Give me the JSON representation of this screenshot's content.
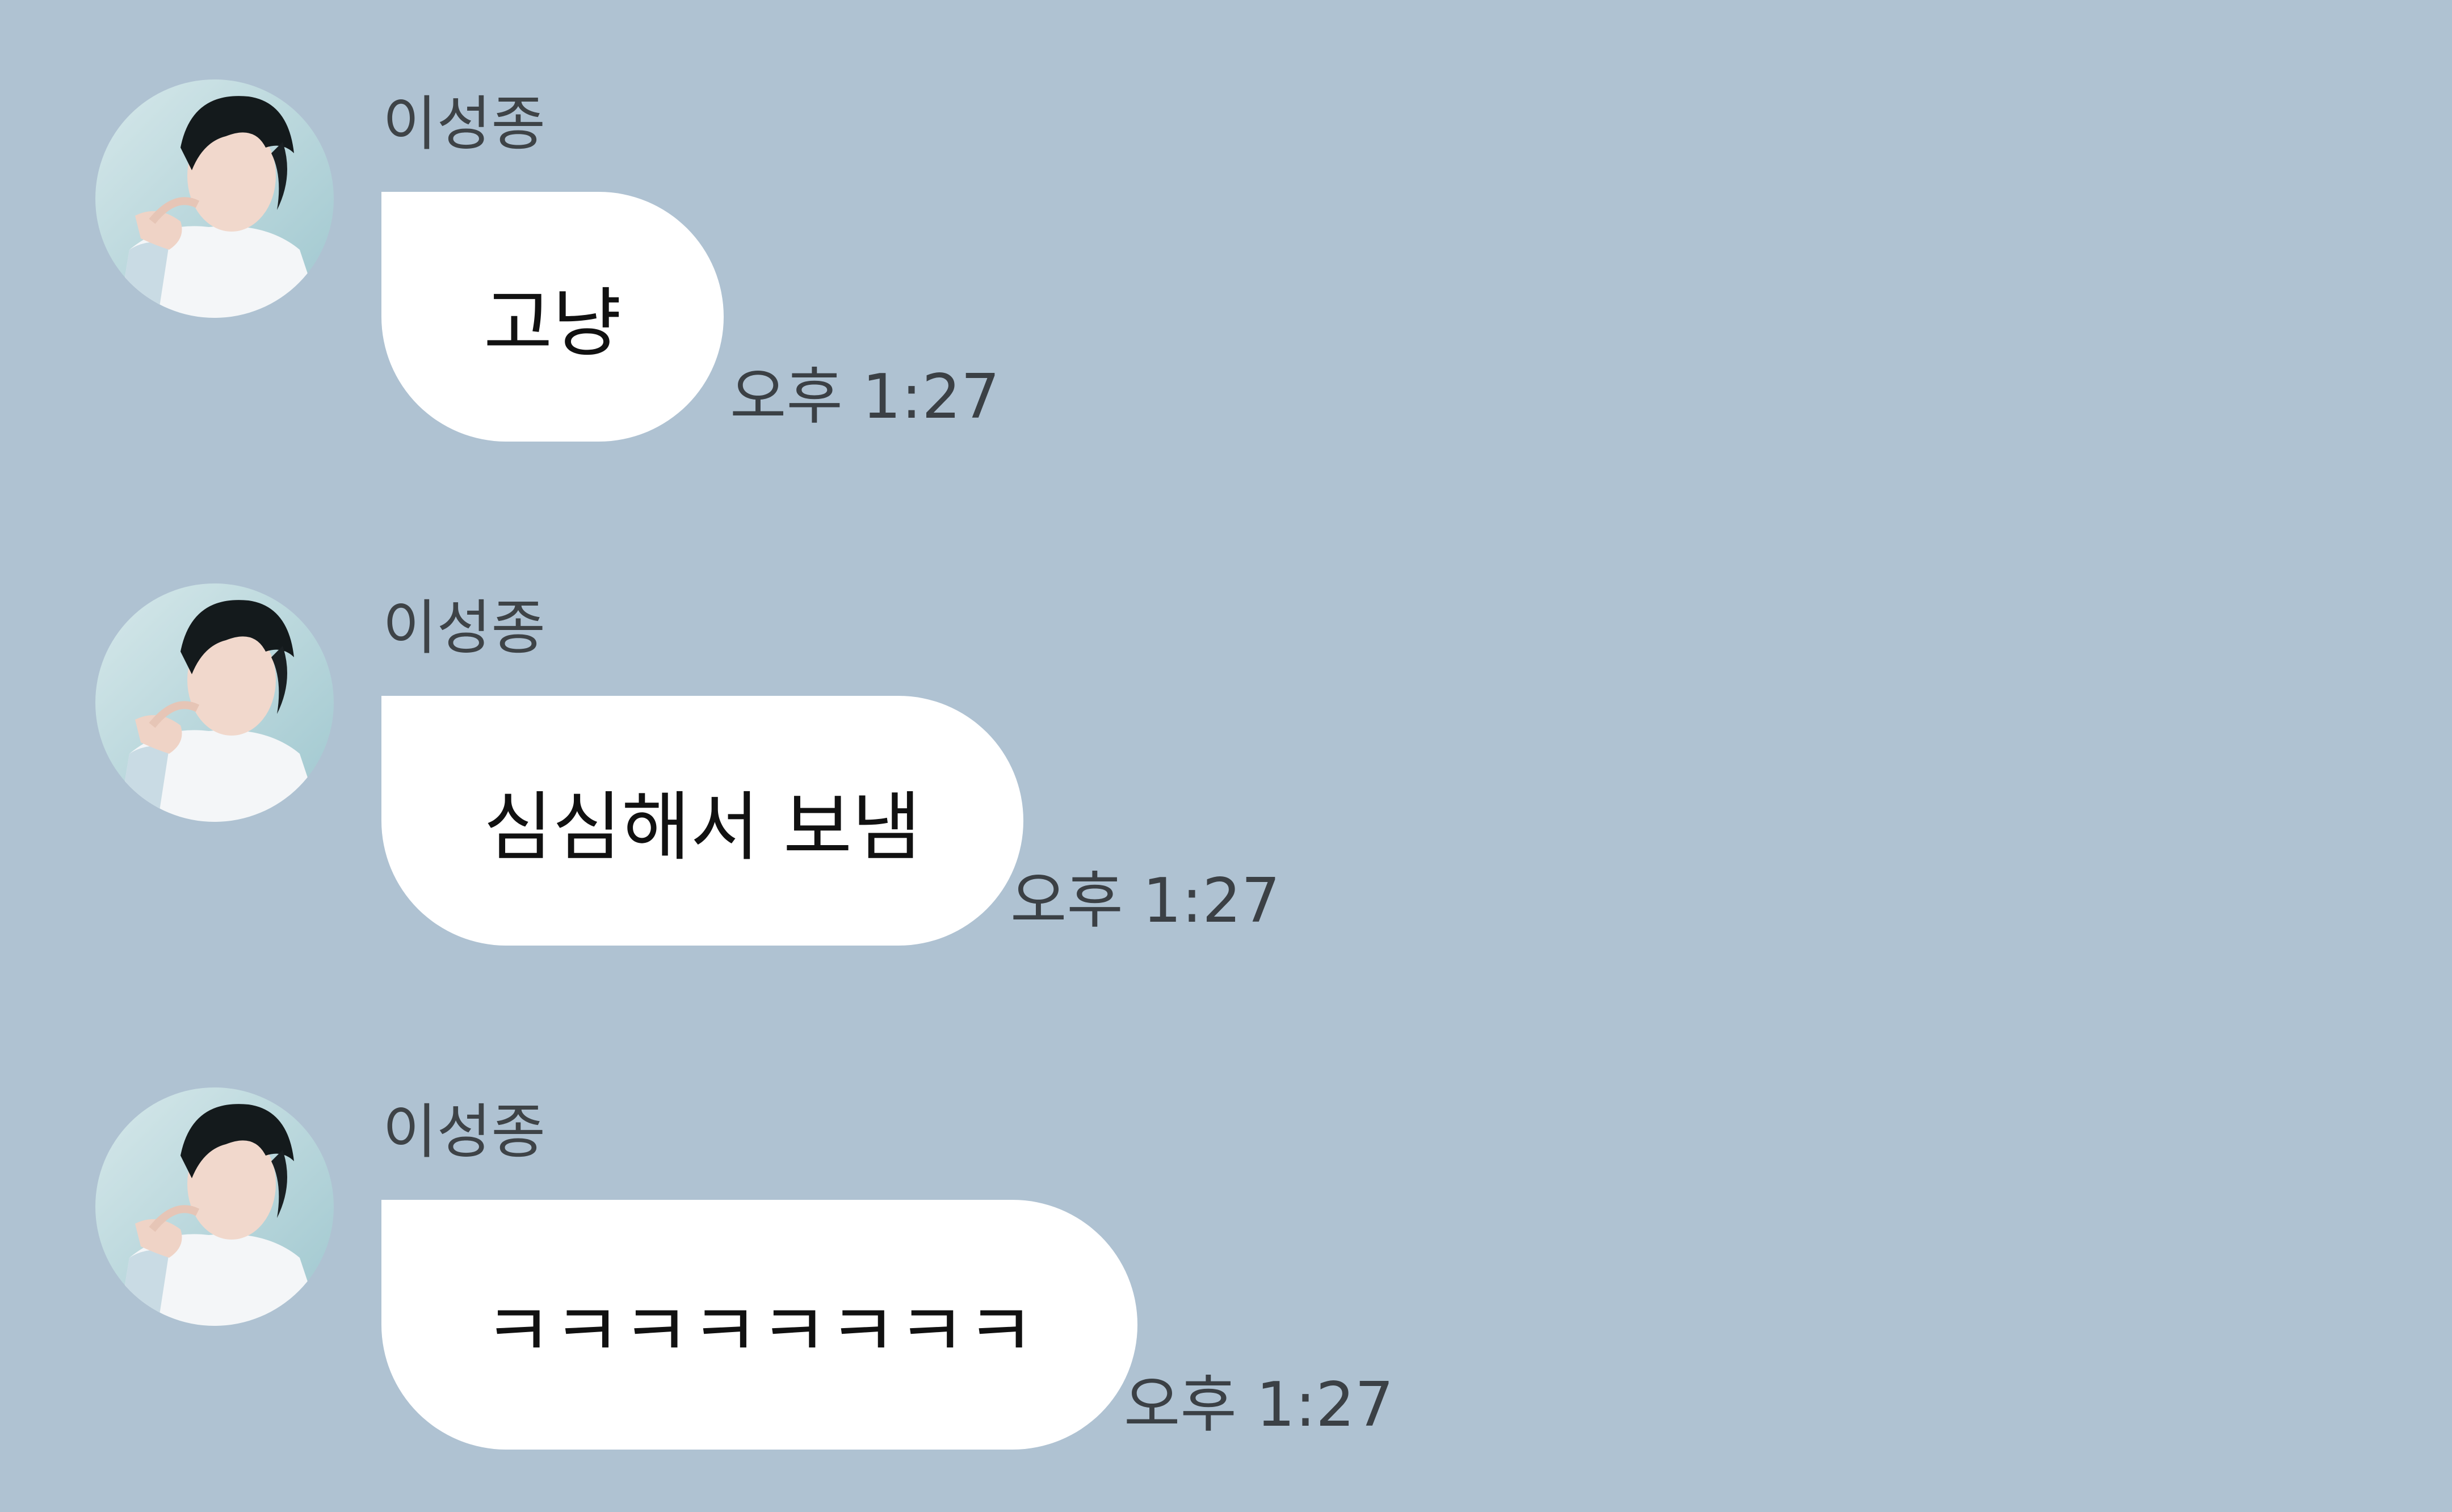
{
  "theme": {
    "background": "#afc2d2",
    "bubble": "#ffffff",
    "sender_text": "#3e4347",
    "time_text": "#3b4045"
  },
  "messages": [
    {
      "sender": "이성종",
      "text": "고냥",
      "time": "오후 1:27",
      "avatar_icon": "profile-photo"
    },
    {
      "sender": "이성종",
      "text": "심심해서 보냄",
      "time": "오후 1:27",
      "avatar_icon": "profile-photo"
    },
    {
      "sender": "이성종",
      "text": "ㅋㅋㅋㅋㅋㅋㅋㅋ",
      "time": "오후 1:27",
      "avatar_icon": "profile-photo"
    }
  ]
}
